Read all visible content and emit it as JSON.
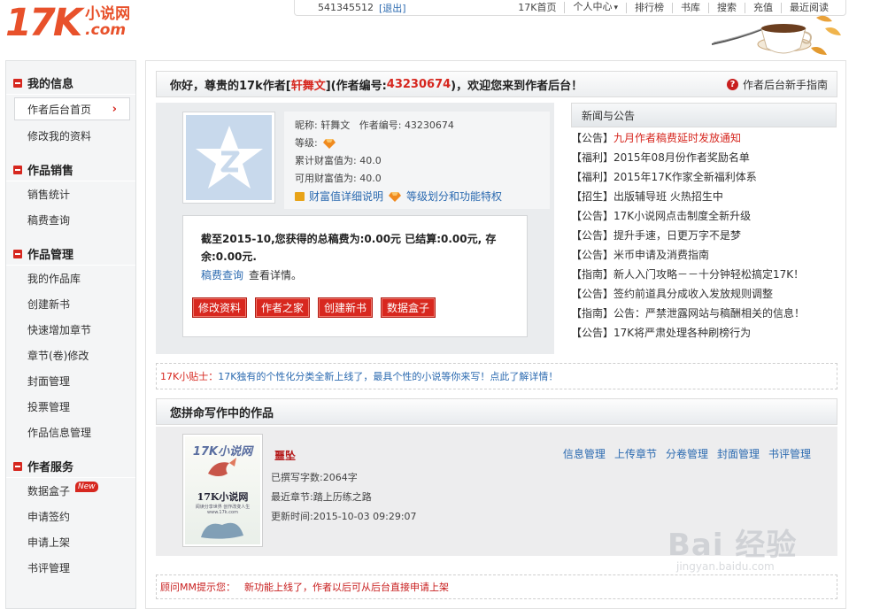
{
  "header": {
    "logo_number": "17K",
    "logo_cn": "小说网",
    "logo_domain": ".com",
    "user_id": "541345512",
    "logout": "[退出]",
    "nav": [
      "17K首页",
      "个人中心",
      "排行榜",
      "书库",
      "搜索",
      "充值",
      "最近阅读"
    ],
    "nav_dropdown_glyph": "▾"
  },
  "sidebar": {
    "sections": [
      {
        "title": "我的信息",
        "items": [
          "作者后台首页",
          "修改我的资料"
        ]
      },
      {
        "title": "作品销售",
        "items": [
          "销售统计",
          "稿费查询"
        ]
      },
      {
        "title": "作品管理",
        "items": [
          "我的作品库",
          "创建新书",
          "快速增加章节",
          "章节(卷)修改",
          "封面管理",
          "投票管理",
          "作品信息管理"
        ]
      },
      {
        "title": "作者服务",
        "items": [
          "数据盒子",
          "申请签约",
          "申请上架",
          "书评管理"
        ]
      }
    ],
    "active_chevron": "›",
    "new_badge": "New"
  },
  "welcome": {
    "prefix": "你好，尊贵的17k作者[",
    "name": "轩舞文",
    "mid": "](作者编号:",
    "id": "43230674",
    "suffix": ")，欢迎您来到作者后台！",
    "guide": "作者后台新手指南",
    "guide_icon": "?"
  },
  "profile": {
    "nickname_label": "昵称:",
    "nickname": "轩舞文",
    "author_id_label": "作者编号:",
    "author_id": "43230674",
    "level_label": "等级:",
    "total_wealth": "累计财富值为: 40.0",
    "available_wealth": "可用财富值为: 40.0",
    "wealth_link": "财富值详细说明",
    "level_link": "等级划分和功能特权"
  },
  "earnings": {
    "text": "截至2015-10,您获得的总稿费为:0.00元 已结算:0.00元, 存余:0.00元.",
    "query_link": "稿费查询",
    "query_suffix": "查看详情。",
    "buttons": [
      "修改资料",
      "作者之家",
      "创建新书",
      "数据盒子"
    ]
  },
  "news": {
    "title": "新闻与公告",
    "items": [
      {
        "cat": "【公告】",
        "title": "九月作者稿费延时发放通知",
        "hot": true
      },
      {
        "cat": "【福利】",
        "title": "2015年08月份作者奖励名单",
        "hot": false
      },
      {
        "cat": "【福利】",
        "title": "2015年17K作家全新福利体系",
        "hot": false
      },
      {
        "cat": "【招生】",
        "title": "出版辅导班 火热招生中",
        "hot": false
      },
      {
        "cat": "【公告】",
        "title": "17K小说网点击制度全新升级",
        "hot": false
      },
      {
        "cat": "【公告】",
        "title": "提升手速，日更万字不是梦",
        "hot": false
      },
      {
        "cat": "【公告】",
        "title": "米币申请及消费指南",
        "hot": false
      },
      {
        "cat": "【指南】",
        "title": "新人入门攻略－－十分钟轻松搞定17K！",
        "hot": false
      },
      {
        "cat": "【公告】",
        "title": "签约前道具分成收入发放规则调整",
        "hot": false
      },
      {
        "cat": "【指南】",
        "title": "公告：严禁泄露网站与稿酬相关的信息！",
        "hot": false
      },
      {
        "cat": "【公告】",
        "title": "17K将严肃处理各种刷榜行为",
        "hot": false
      }
    ]
  },
  "tip": {
    "label": "17K小贴士：",
    "text": "17K独有的个性化分类全新上线了，最具个性的小说等你来写！点此了解详情！"
  },
  "works": {
    "title": "您拼命写作中的作品",
    "book": {
      "name": "噩坠",
      "words": "已撰写字数:2064字",
      "latest": "最近章节:踏上历练之路",
      "updated": "更新时间:2015-10-03 09:29:07",
      "actions": [
        "信息管理",
        "上传章节",
        "分卷管理",
        "封面管理",
        "书评管理"
      ],
      "cover_brand": "17K小说网",
      "cover_name": "17K小说网",
      "cover_tag": "阅读分享世界 创作改变人生 www.17k.com"
    }
  },
  "notice": {
    "label": "顾问MM提示您：",
    "text": "新功能上线了，作者以后可从后台直接申请上架"
  },
  "watermark": {
    "main": "Bai 经验",
    "sub": "jingyan.baidu.com"
  },
  "colors": {
    "brand": "#e8512b",
    "accent_red": "#d6271f",
    "link_blue": "#2b6ab0"
  }
}
